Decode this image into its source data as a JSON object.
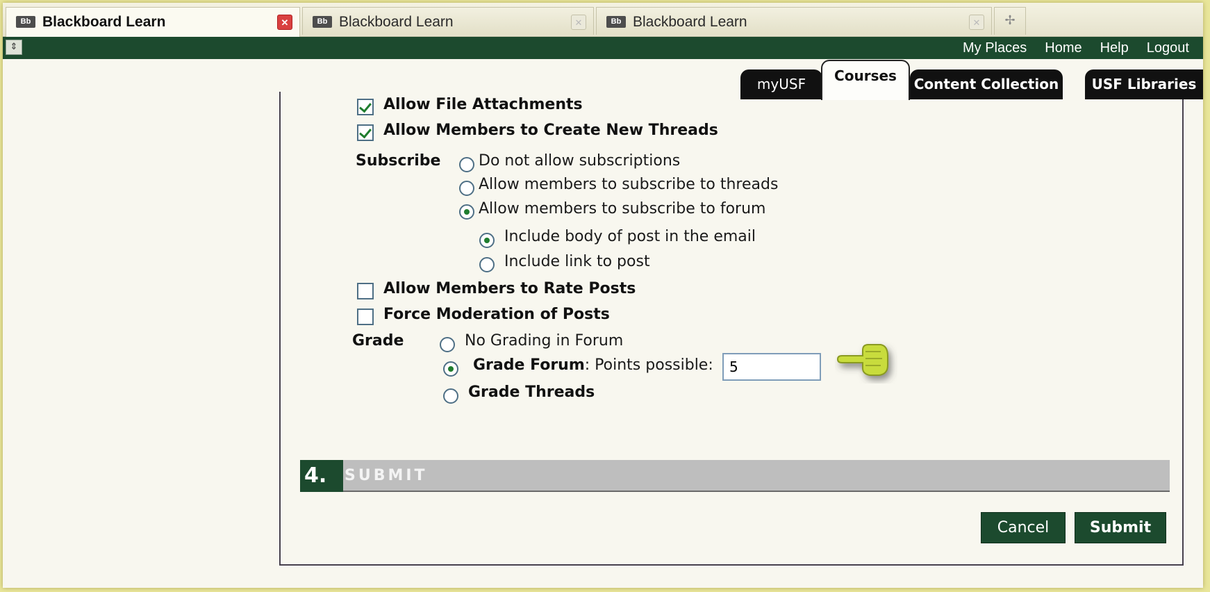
{
  "browser": {
    "tabs": [
      {
        "label": "Blackboard Learn",
        "active": true
      },
      {
        "label": "Blackboard Learn",
        "active": false
      },
      {
        "label": "Blackboard Learn",
        "active": false
      }
    ],
    "favicon_text": "Bb",
    "close_glyph": "✕",
    "new_tab_glyph": "✢"
  },
  "topbar": {
    "collapse_glyph": "⇕",
    "links": [
      "My Places",
      "Home",
      "Help",
      "Logout"
    ]
  },
  "nav_tabs": [
    "myUSF",
    "Courses",
    "Content Collection",
    "USF Libraries"
  ],
  "active_nav_tab": "Courses",
  "options": {
    "allow_file_attachments": {
      "label": "Allow File Attachments",
      "checked": true
    },
    "allow_new_threads": {
      "label": "Allow Members to Create New Threads",
      "checked": true
    },
    "subscribe": {
      "label": "Subscribe",
      "choices": [
        {
          "label": "Do not allow subscriptions",
          "selected": false
        },
        {
          "label": "Allow members to subscribe to threads",
          "selected": false
        },
        {
          "label": "Allow members to subscribe to forum",
          "selected": true
        }
      ],
      "sub_choices": [
        {
          "label": "Include body of post in the email",
          "selected": true
        },
        {
          "label": "Include link to post",
          "selected": false
        }
      ]
    },
    "allow_rate_posts": {
      "label": "Allow Members to Rate Posts",
      "checked": false
    },
    "force_moderation": {
      "label": "Force Moderation of Posts",
      "checked": false
    },
    "grade": {
      "label": "Grade",
      "no_grading": "No Grading in Forum",
      "grade_forum": "Grade Forum",
      "points_label": ": Points possible:",
      "points_value": "5",
      "grade_threads": "Grade Threads",
      "selected": "Grade Forum"
    }
  },
  "submit_section": {
    "number": "4.",
    "title": "SUBMIT"
  },
  "buttons": {
    "cancel": "Cancel",
    "submit": "Submit"
  },
  "colors": {
    "bb_green": "#1c4a2e",
    "frame_yellow": "#e9e69a",
    "pointer_green": "#c8dc3c"
  }
}
